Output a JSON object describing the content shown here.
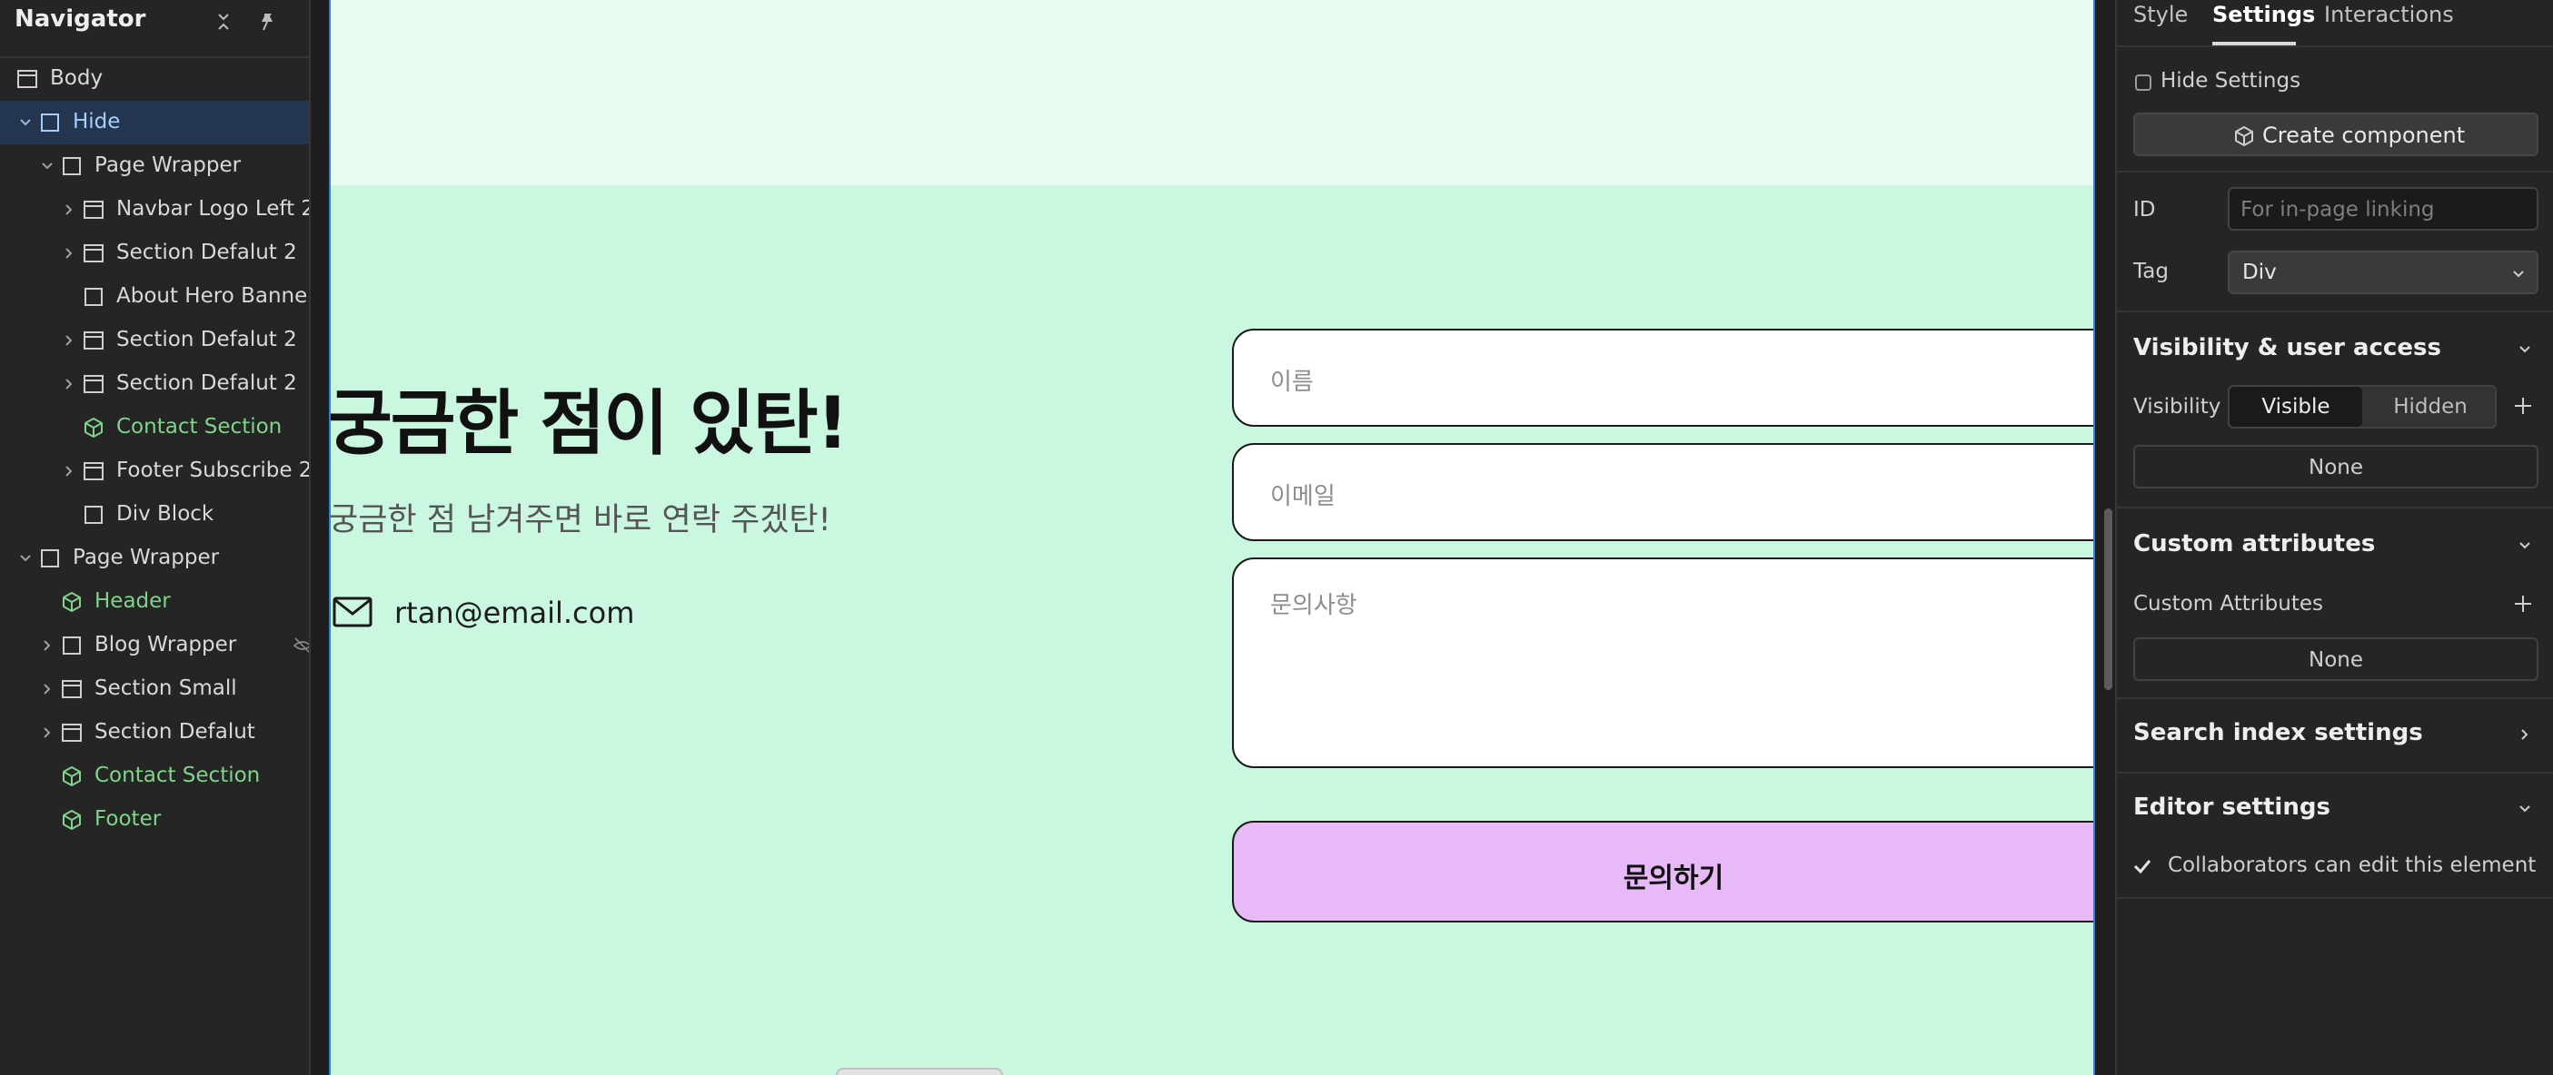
{
  "navigator": {
    "title": "Navigator",
    "items": [
      {
        "label": "Body"
      },
      {
        "label": "Hide"
      },
      {
        "label": "Page Wrapper"
      },
      {
        "label": "Navbar Logo Left 2"
      },
      {
        "label": "Section Defalut 2"
      },
      {
        "label": "About Hero Banne..."
      },
      {
        "label": "Section Defalut 2"
      },
      {
        "label": "Section Defalut 2"
      },
      {
        "label": "Contact Section"
      },
      {
        "label": "Footer Subscribe 2"
      },
      {
        "label": "Div Block"
      },
      {
        "label": "Page Wrapper"
      },
      {
        "label": "Header"
      },
      {
        "label": "Blog Wrapper"
      },
      {
        "label": "Section Small"
      },
      {
        "label": "Section Defalut"
      },
      {
        "label": "Contact Section"
      },
      {
        "label": "Footer"
      }
    ]
  },
  "canvas": {
    "heading": "궁금한 점이 있탄!",
    "subheading": "궁금한 점 남겨주면 바로 연락 주겠탄!",
    "email": "rtan@email.com",
    "form": {
      "name_placeholder": "이름",
      "email_placeholder": "이메일",
      "message_placeholder": "문의사항",
      "submit_label": "문의하기"
    }
  },
  "panel": {
    "tabs": [
      "Style",
      "Settings",
      "Interactions"
    ],
    "active_tab": "Settings",
    "hide_settings": "Hide Settings",
    "create_component": "Create component",
    "id_label": "ID",
    "id_placeholder": "For in-page linking",
    "tag_label": "Tag",
    "tag_value": "Div",
    "visibility_section": "Visibility & user access",
    "visibility_label": "Visibility",
    "visibility_options": [
      "Visible",
      "Hidden"
    ],
    "visibility_selected": "Visible",
    "visibility_none": "None",
    "custom_attributes_section": "Custom attributes",
    "custom_attributes_label": "Custom Attributes",
    "custom_attributes_none": "None",
    "search_index_section": "Search index settings",
    "editor_settings_section": "Editor settings",
    "collaborators_label": "Collaborators can edit this element",
    "collaborators_checked": true
  },
  "colors": {
    "accent_blue": "#2f7de1",
    "component_green": "#7fd48a",
    "contact_bg": "#c9f7e0",
    "hero_bg": "#e8fbf1",
    "button_purple": "#e7b9f6"
  }
}
